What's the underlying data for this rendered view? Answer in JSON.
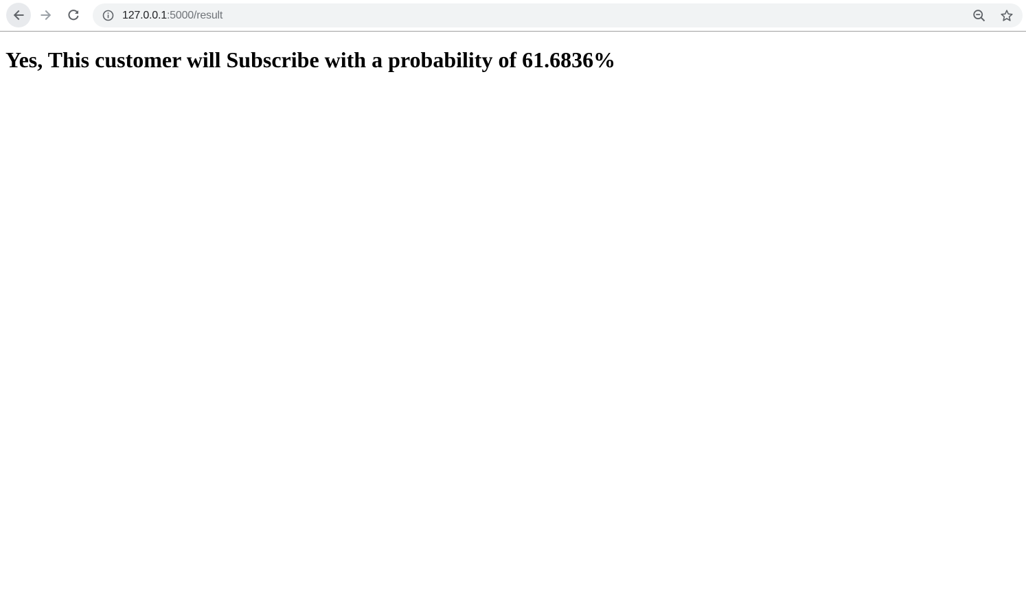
{
  "browser": {
    "url_host": "127.0.0.1",
    "url_rest": ":5000/result",
    "icons": {
      "back": "arrow-left",
      "forward": "arrow-right",
      "reload": "reload",
      "site_info": "info-circle",
      "zoom": "zoom-out-magnifier",
      "bookmark": "star-outline"
    },
    "colors": {
      "omnibox_bg": "#f1f3f4",
      "icon_active": "#5f6368",
      "icon_disabled": "#9aa0a6",
      "url_host": "#202124",
      "url_path": "#6f7378"
    }
  },
  "page": {
    "result_heading": "Yes, This customer will Subscribe with a probability of 61.6836%"
  }
}
